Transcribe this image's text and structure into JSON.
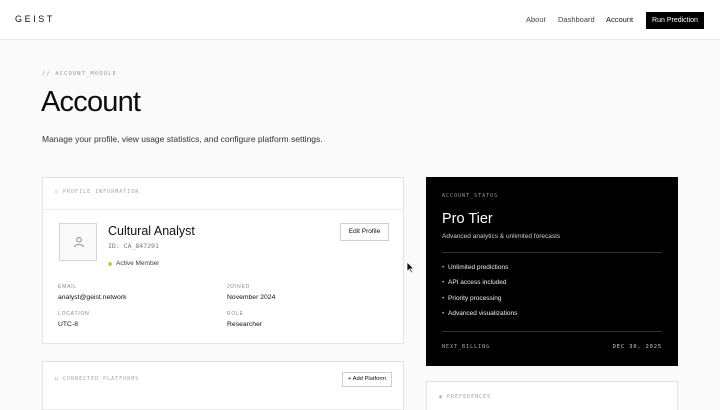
{
  "header": {
    "logo": "GEIST",
    "nav": [
      {
        "label": "About",
        "active": false
      },
      {
        "label": "Dashboard",
        "active": false
      },
      {
        "label": "Account",
        "active": true
      }
    ],
    "cta": "Run Prediction"
  },
  "page": {
    "eyebrow": "// ACCOUNT_MODULE",
    "title": "Account",
    "subtitle": "Manage your profile, view usage statistics, and configure platform settings."
  },
  "profile": {
    "section_label": "PROFILE_INFORMATION",
    "name": "Cultural Analyst",
    "id": "ID: CA_847291",
    "status": "Active Member",
    "status_color": "#c4cd5a",
    "edit_label": "Edit Profile",
    "fields": {
      "email": {
        "label": "EMAIL",
        "value": "analyst@geist.network"
      },
      "joined": {
        "label": "JOINED",
        "value": "November 2024"
      },
      "location": {
        "label": "LOCATION",
        "value": "UTC-8"
      },
      "role": {
        "label": "ROLE",
        "value": "Researcher"
      }
    }
  },
  "account_status": {
    "label": "ACCOUNT_STATUS",
    "tier": "Pro Tier",
    "description": "Advanced analytics & unlimited forecasts",
    "features": [
      "Unlimited predictions",
      "API access included",
      "Priority processing",
      "Advanced visualizations"
    ],
    "billing_label": "NEXT_BILLING",
    "billing_date": "DEC 30, 2025"
  },
  "platforms": {
    "label": "CONNECTED_PLATFORMS",
    "add_label": "+ Add Platform"
  },
  "preferences": {
    "label": "PREFERENCES"
  },
  "colors": {
    "accent": "#000000",
    "background": "#fafafa",
    "status_card": "#000000"
  }
}
